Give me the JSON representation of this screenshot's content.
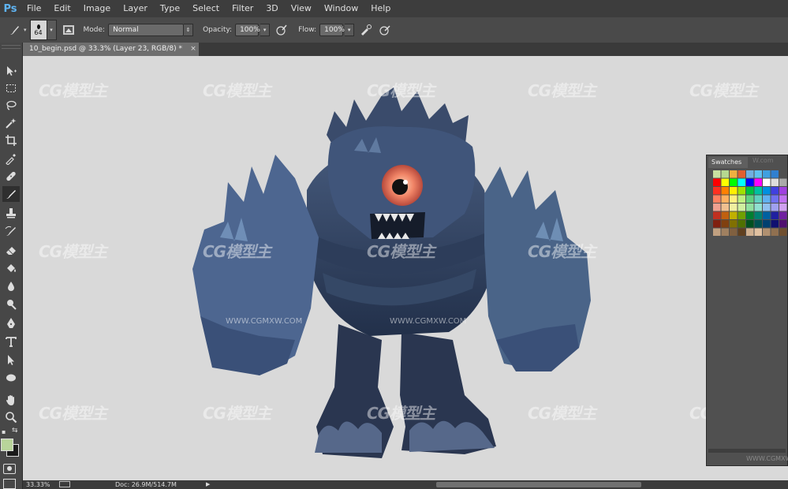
{
  "app": {
    "logo": "Ps"
  },
  "menu": [
    "File",
    "Edit",
    "Image",
    "Layer",
    "Type",
    "Select",
    "Filter",
    "3D",
    "View",
    "Window",
    "Help"
  ],
  "options": {
    "brush_size": "64",
    "mode_label": "Mode:",
    "mode_value": "Normal",
    "opacity_label": "Opacity:",
    "opacity_value": "100%",
    "flow_label": "Flow:",
    "flow_value": "100%"
  },
  "document": {
    "tab_title": "10_begin.psd @ 33.3% (Layer 23, RGB/8) *",
    "close": "×"
  },
  "status": {
    "zoom": "33.33%",
    "doc_info": "Doc: 26.9M/514.7M"
  },
  "panel": {
    "swatches_tab": "Swatches",
    "ghost_tab": "W.com"
  },
  "colors": {
    "foreground": "#b8d49a",
    "background": "#1a1a1a",
    "accent": "#5fb4f4"
  },
  "watermark": {
    "logo": "CG模型主",
    "url": "WWW.CGMXW.COM"
  },
  "toolbar_icons": [
    "move-icon",
    "marquee-icon",
    "lasso-icon",
    "quick-select-icon",
    "crop-icon",
    "eyedropper-icon",
    "healing-icon",
    "brush-icon",
    "clone-stamp-icon",
    "history-brush-icon",
    "eraser-icon",
    "paint-bucket-icon",
    "blur-icon",
    "dodge-icon",
    "pen-icon",
    "type-icon",
    "path-select-icon",
    "ellipse-icon",
    "hand-icon",
    "zoom-icon"
  ]
}
